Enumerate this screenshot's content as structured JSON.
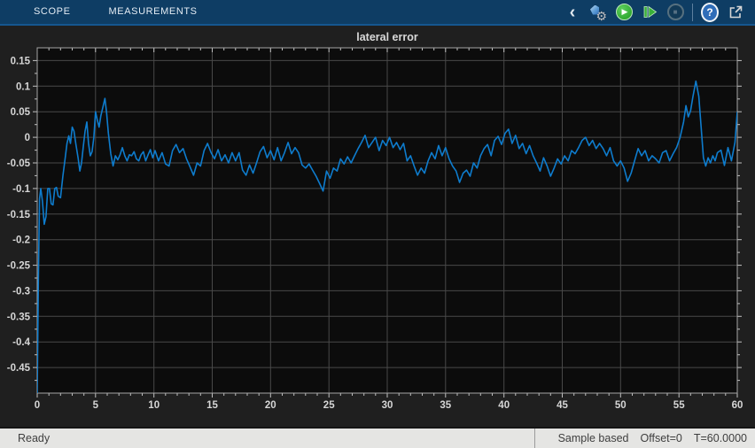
{
  "header": {
    "tabs": [
      {
        "label": "SCOPE"
      },
      {
        "label": "MEASUREMENTS"
      }
    ],
    "toolbar_icons": [
      {
        "name": "collapse-toolstrip",
        "glyph": "‹"
      },
      {
        "name": "settings-gear",
        "glyph": "⚙"
      },
      {
        "name": "run",
        "glyph": "▶"
      },
      {
        "name": "step-forward",
        "glyph": "▶"
      },
      {
        "name": "stop",
        "glyph": "■"
      },
      {
        "name": "help",
        "glyph": "?"
      },
      {
        "name": "pop-out-window",
        "glyph": "↗"
      }
    ]
  },
  "status_bar": {
    "left": "Ready",
    "right_items": [
      "Sample based",
      "Offset=0",
      "T=60.0000"
    ]
  },
  "colors": {
    "header_bg": "#0e3d64",
    "figure_bg": "#1f1f1f",
    "plot_bg": "#0c0c0c",
    "grid": "#494949",
    "axis_border": "#a6a6a6",
    "tick": "#c2c2c2",
    "tick_label": "#d6d6d6",
    "line": "#0e7ccd",
    "status_bg": "#e5e5e3"
  },
  "chart_data": {
    "type": "line",
    "title": "lateral error",
    "xlabel": "",
    "ylabel": "",
    "xlim": [
      0,
      60
    ],
    "ylim": [
      -0.5,
      0.175
    ],
    "xticks": [
      0,
      5,
      10,
      15,
      20,
      25,
      30,
      35,
      40,
      45,
      50,
      55,
      60
    ],
    "yticks": [
      0.15,
      0.1,
      0.05,
      0,
      -0.05,
      -0.1,
      -0.15,
      -0.2,
      -0.25,
      -0.3,
      -0.35,
      -0.4,
      -0.45
    ],
    "x_minor_step": 1,
    "y_minor_step": 0.025,
    "grid": true,
    "legend": null,
    "series": [
      {
        "name": "lateral error",
        "points": [
          [
            0,
            -0.5
          ],
          [
            0.1,
            -0.28
          ],
          [
            0.2,
            -0.12
          ],
          [
            0.3,
            -0.1
          ],
          [
            0.45,
            -0.125
          ],
          [
            0.6,
            -0.17
          ],
          [
            0.75,
            -0.155
          ],
          [
            0.9,
            -0.1
          ],
          [
            1.05,
            -0.1
          ],
          [
            1.2,
            -0.13
          ],
          [
            1.35,
            -0.132
          ],
          [
            1.5,
            -0.1
          ],
          [
            1.65,
            -0.098
          ],
          [
            1.8,
            -0.115
          ],
          [
            2,
            -0.118
          ],
          [
            2.2,
            -0.075
          ],
          [
            2.4,
            -0.04
          ],
          [
            2.55,
            -0.012
          ],
          [
            2.7,
            0.003
          ],
          [
            2.85,
            -0.012
          ],
          [
            3,
            0.02
          ],
          [
            3.15,
            0.012
          ],
          [
            3.3,
            -0.012
          ],
          [
            3.5,
            -0.04
          ],
          [
            3.65,
            -0.066
          ],
          [
            3.8,
            -0.05
          ],
          [
            3.95,
            -0.018
          ],
          [
            4.1,
            0.012
          ],
          [
            4.25,
            0.03
          ],
          [
            4.4,
            -0.012
          ],
          [
            4.55,
            -0.036
          ],
          [
            4.7,
            -0.028
          ],
          [
            4.85,
            0
          ],
          [
            5,
            0.05
          ],
          [
            5.15,
            0.034
          ],
          [
            5.3,
            0.02
          ],
          [
            5.45,
            0.042
          ],
          [
            5.6,
            0.056
          ],
          [
            5.8,
            0.076
          ],
          [
            5.95,
            0.048
          ],
          [
            6.1,
            0.008
          ],
          [
            6.3,
            -0.032
          ],
          [
            6.5,
            -0.056
          ],
          [
            6.7,
            -0.036
          ],
          [
            6.9,
            -0.044
          ],
          [
            7.1,
            -0.034
          ],
          [
            7.3,
            -0.02
          ],
          [
            7.5,
            -0.036
          ],
          [
            7.7,
            -0.046
          ],
          [
            7.9,
            -0.034
          ],
          [
            8.1,
            -0.036
          ],
          [
            8.3,
            -0.028
          ],
          [
            8.5,
            -0.042
          ],
          [
            8.7,
            -0.046
          ],
          [
            8.9,
            -0.034
          ],
          [
            9.1,
            -0.028
          ],
          [
            9.3,
            -0.046
          ],
          [
            9.5,
            -0.034
          ],
          [
            9.7,
            -0.024
          ],
          [
            9.9,
            -0.04
          ],
          [
            10.1,
            -0.026
          ],
          [
            10.4,
            -0.046
          ],
          [
            10.7,
            -0.03
          ],
          [
            11,
            -0.052
          ],
          [
            11.3,
            -0.056
          ],
          [
            11.6,
            -0.026
          ],
          [
            11.9,
            -0.014
          ],
          [
            12.2,
            -0.03
          ],
          [
            12.5,
            -0.022
          ],
          [
            12.8,
            -0.042
          ],
          [
            13.1,
            -0.058
          ],
          [
            13.4,
            -0.074
          ],
          [
            13.7,
            -0.05
          ],
          [
            14,
            -0.056
          ],
          [
            14.3,
            -0.026
          ],
          [
            14.6,
            -0.012
          ],
          [
            14.9,
            -0.03
          ],
          [
            15.2,
            -0.042
          ],
          [
            15.5,
            -0.024
          ],
          [
            15.8,
            -0.046
          ],
          [
            16.1,
            -0.034
          ],
          [
            16.4,
            -0.05
          ],
          [
            16.7,
            -0.03
          ],
          [
            17,
            -0.046
          ],
          [
            17.3,
            -0.03
          ],
          [
            17.6,
            -0.064
          ],
          [
            17.9,
            -0.074
          ],
          [
            18.2,
            -0.054
          ],
          [
            18.5,
            -0.07
          ],
          [
            18.8,
            -0.05
          ],
          [
            19.1,
            -0.028
          ],
          [
            19.4,
            -0.018
          ],
          [
            19.7,
            -0.04
          ],
          [
            20,
            -0.026
          ],
          [
            20.3,
            -0.044
          ],
          [
            20.6,
            -0.02
          ],
          [
            20.9,
            -0.046
          ],
          [
            21.2,
            -0.03
          ],
          [
            21.5,
            -0.01
          ],
          [
            21.8,
            -0.032
          ],
          [
            22.1,
            -0.02
          ],
          [
            22.4,
            -0.03
          ],
          [
            22.7,
            -0.054
          ],
          [
            23,
            -0.06
          ],
          [
            23.3,
            -0.052
          ],
          [
            23.6,
            -0.064
          ],
          [
            23.9,
            -0.076
          ],
          [
            24.2,
            -0.09
          ],
          [
            24.5,
            -0.105
          ],
          [
            24.8,
            -0.066
          ],
          [
            25.1,
            -0.08
          ],
          [
            25.4,
            -0.06
          ],
          [
            25.7,
            -0.066
          ],
          [
            26,
            -0.042
          ],
          [
            26.3,
            -0.052
          ],
          [
            26.6,
            -0.038
          ],
          [
            26.9,
            -0.05
          ],
          [
            27.2,
            -0.036
          ],
          [
            27.5,
            -0.022
          ],
          [
            27.8,
            -0.01
          ],
          [
            28.1,
            0.004
          ],
          [
            28.4,
            -0.02
          ],
          [
            28.7,
            -0.01
          ],
          [
            29,
            0
          ],
          [
            29.3,
            -0.026
          ],
          [
            29.6,
            -0.006
          ],
          [
            29.9,
            -0.016
          ],
          [
            30.2,
            0
          ],
          [
            30.5,
            -0.02
          ],
          [
            30.8,
            -0.01
          ],
          [
            31.1,
            -0.024
          ],
          [
            31.4,
            -0.012
          ],
          [
            31.7,
            -0.046
          ],
          [
            32,
            -0.036
          ],
          [
            32.3,
            -0.056
          ],
          [
            32.6,
            -0.074
          ],
          [
            32.9,
            -0.06
          ],
          [
            33.2,
            -0.07
          ],
          [
            33.5,
            -0.046
          ],
          [
            33.8,
            -0.03
          ],
          [
            34.1,
            -0.042
          ],
          [
            34.4,
            -0.016
          ],
          [
            34.7,
            -0.036
          ],
          [
            35,
            -0.02
          ],
          [
            35.3,
            -0.042
          ],
          [
            35.6,
            -0.056
          ],
          [
            35.9,
            -0.066
          ],
          [
            36.2,
            -0.088
          ],
          [
            36.5,
            -0.07
          ],
          [
            36.8,
            -0.064
          ],
          [
            37.1,
            -0.076
          ],
          [
            37.4,
            -0.05
          ],
          [
            37.7,
            -0.06
          ],
          [
            38,
            -0.036
          ],
          [
            38.3,
            -0.022
          ],
          [
            38.6,
            -0.014
          ],
          [
            38.9,
            -0.036
          ],
          [
            39.2,
            -0.006
          ],
          [
            39.5,
            0.002
          ],
          [
            39.8,
            -0.014
          ],
          [
            40.1,
            0.008
          ],
          [
            40.4,
            0.016
          ],
          [
            40.7,
            -0.012
          ],
          [
            41,
            0.004
          ],
          [
            41.3,
            -0.022
          ],
          [
            41.6,
            -0.012
          ],
          [
            41.9,
            -0.032
          ],
          [
            42.2,
            -0.016
          ],
          [
            42.5,
            -0.036
          ],
          [
            42.8,
            -0.05
          ],
          [
            43.1,
            -0.066
          ],
          [
            43.4,
            -0.04
          ],
          [
            43.7,
            -0.056
          ],
          [
            44,
            -0.076
          ],
          [
            44.3,
            -0.06
          ],
          [
            44.6,
            -0.042
          ],
          [
            44.9,
            -0.052
          ],
          [
            45.2,
            -0.036
          ],
          [
            45.5,
            -0.046
          ],
          [
            45.8,
            -0.026
          ],
          [
            46.1,
            -0.032
          ],
          [
            46.4,
            -0.02
          ],
          [
            46.7,
            -0.006
          ],
          [
            47,
            0
          ],
          [
            47.3,
            -0.016
          ],
          [
            47.6,
            -0.006
          ],
          [
            47.9,
            -0.022
          ],
          [
            48.2,
            -0.012
          ],
          [
            48.5,
            -0.022
          ],
          [
            48.8,
            -0.036
          ],
          [
            49.1,
            -0.02
          ],
          [
            49.4,
            -0.046
          ],
          [
            49.7,
            -0.056
          ],
          [
            50,
            -0.046
          ],
          [
            50.3,
            -0.06
          ],
          [
            50.6,
            -0.086
          ],
          [
            50.9,
            -0.07
          ],
          [
            51.2,
            -0.046
          ],
          [
            51.5,
            -0.022
          ],
          [
            51.8,
            -0.036
          ],
          [
            52.1,
            -0.026
          ],
          [
            52.4,
            -0.046
          ],
          [
            52.7,
            -0.036
          ],
          [
            53,
            -0.042
          ],
          [
            53.3,
            -0.05
          ],
          [
            53.6,
            -0.03
          ],
          [
            53.9,
            -0.026
          ],
          [
            54.2,
            -0.046
          ],
          [
            54.5,
            -0.032
          ],
          [
            54.8,
            -0.02
          ],
          [
            55.1,
            0
          ],
          [
            55.4,
            0.03
          ],
          [
            55.6,
            0.062
          ],
          [
            55.8,
            0.04
          ],
          [
            56,
            0.052
          ],
          [
            56.2,
            0.08
          ],
          [
            56.45,
            0.11
          ],
          [
            56.7,
            0.08
          ],
          [
            56.9,
            0.02
          ],
          [
            57.1,
            -0.04
          ],
          [
            57.3,
            -0.056
          ],
          [
            57.5,
            -0.04
          ],
          [
            57.7,
            -0.05
          ],
          [
            57.9,
            -0.036
          ],
          [
            58.1,
            -0.046
          ],
          [
            58.3,
            -0.03
          ],
          [
            58.6,
            -0.025
          ],
          [
            58.9,
            -0.055
          ],
          [
            59.2,
            -0.02
          ],
          [
            59.5,
            -0.046
          ],
          [
            59.8,
            -0.01
          ],
          [
            60,
            0.05
          ]
        ]
      }
    ]
  }
}
